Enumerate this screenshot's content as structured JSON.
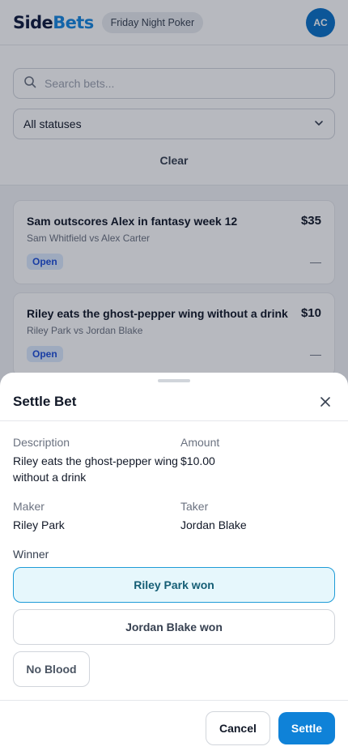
{
  "app": {
    "logo_part1": "Side",
    "logo_part2": "Bets",
    "group": "Friday Night Poker",
    "avatar_initials": "AC"
  },
  "filters": {
    "search_placeholder": "Search bets...",
    "status_select": "All statuses",
    "clear_label": "Clear"
  },
  "bets": [
    {
      "title": "Sam outscores Alex in fantasy week 12",
      "amount": "$35",
      "parties": "Sam Whitfield vs Alex Carter",
      "status": "Open",
      "result": "—"
    },
    {
      "title": "Riley eats the ghost-pepper wing without a drink",
      "amount": "$10",
      "parties": "Riley Park vs Jordan Blake",
      "status": "Open",
      "result": "—"
    }
  ],
  "sheet": {
    "title": "Settle Bet",
    "description_label": "Description",
    "description_value": "Riley eats the ghost-pepper wing without a drink",
    "amount_label": "Amount",
    "amount_value": "$10.00",
    "maker_label": "Maker",
    "maker_value": "Riley Park",
    "taker_label": "Taker",
    "taker_value": "Jordan Blake",
    "winner_label": "Winner",
    "options": [
      "Riley Park won",
      "Jordan Blake won",
      "No Blood"
    ],
    "selected_option": "Riley Park won",
    "cancel_label": "Cancel",
    "settle_label": "Settle"
  },
  "colors": {
    "brand": "#1687e0",
    "accent": "#0f82d8",
    "selected_bg": "#e6f7fc",
    "selected_border": "#1e9bd7",
    "badge_bg": "#dbeafe"
  },
  "icons": {
    "search": "search-icon",
    "chevron": "chevron-down-icon",
    "close": "close-icon"
  }
}
